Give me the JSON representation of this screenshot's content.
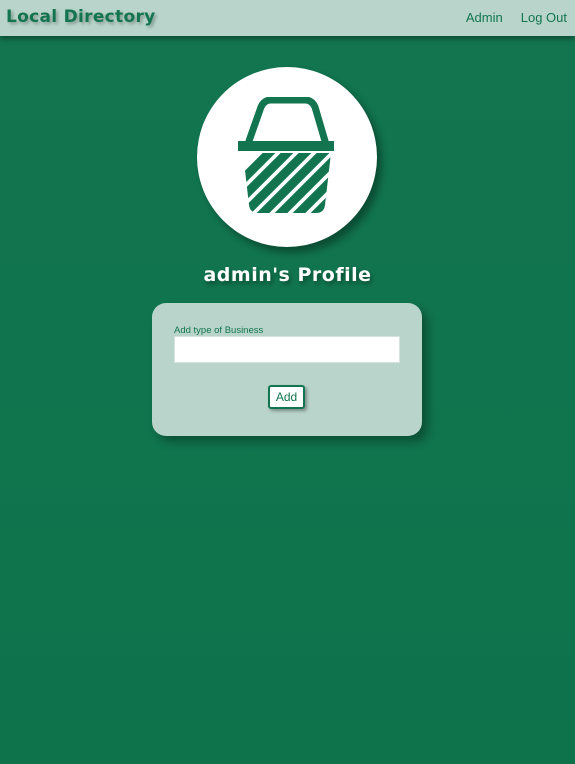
{
  "navbar": {
    "brand": "Local Directory",
    "links": [
      {
        "label": "Admin"
      },
      {
        "label": "Log Out"
      }
    ]
  },
  "avatar": {
    "icon": "shopping-basket-icon",
    "color": "#127550"
  },
  "profile": {
    "title": "admin's Profile"
  },
  "form": {
    "label": "Add type of Business",
    "value": "",
    "placeholder": "",
    "submit_label": "Add"
  },
  "colors": {
    "background": "#127550",
    "panel": "#b9d5cb",
    "accent": "#127550",
    "white": "#ffffff"
  }
}
